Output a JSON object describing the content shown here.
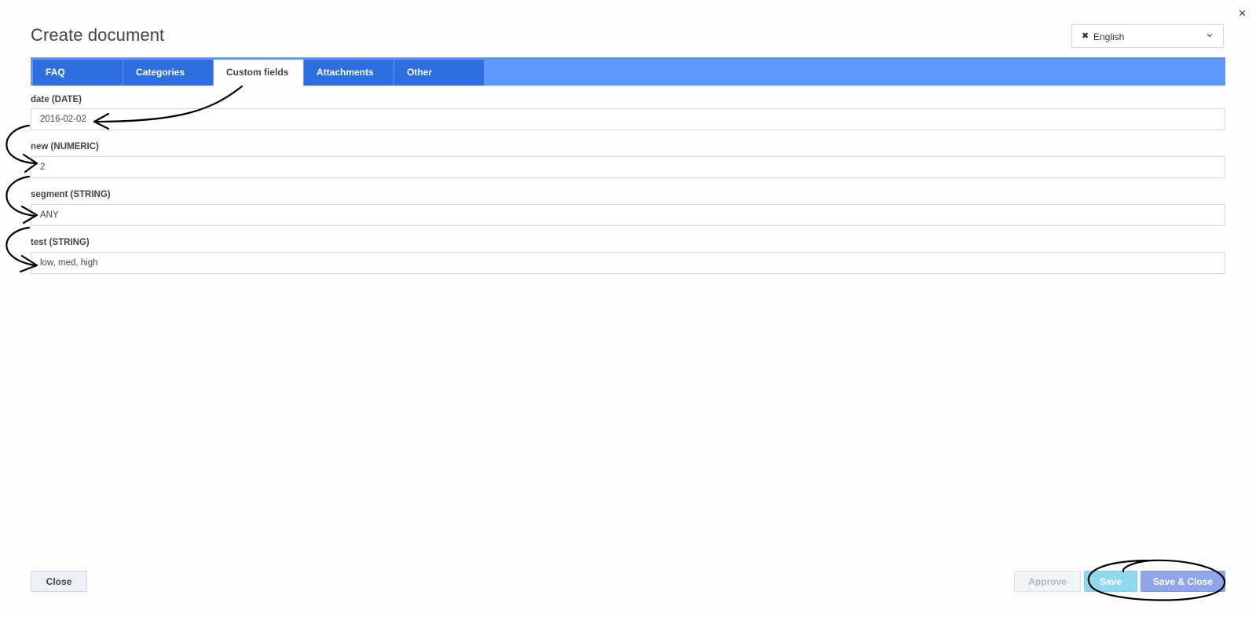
{
  "dialog": {
    "title": "Create document",
    "close_symbol": "×"
  },
  "language_select": {
    "value": "English",
    "remove_symbol": "✖",
    "icon": "chevron-down-icon"
  },
  "tabs": [
    {
      "label": "FAQ",
      "active": false
    },
    {
      "label": "Categories",
      "active": false
    },
    {
      "label": "Custom fields",
      "active": true
    },
    {
      "label": "Attachments",
      "active": false
    },
    {
      "label": "Other",
      "active": false
    }
  ],
  "fields": [
    {
      "label": "date (DATE)",
      "value": "2016-02-02"
    },
    {
      "label": "new (NUMERIC)",
      "value": "2"
    },
    {
      "label": "segment (STRING)",
      "value": "ANY"
    },
    {
      "label": "test (STRING)",
      "value": "low, med, high"
    }
  ],
  "footer": {
    "close_label": "Close",
    "approve_label": "Approve",
    "save_label": "Save",
    "save_close_label": "Save & Close"
  },
  "colors": {
    "tab_bar": "#5c98fd",
    "tab": "#2f6ee0",
    "save": "#8fd8ee",
    "save_close": "#8fa7ea"
  }
}
